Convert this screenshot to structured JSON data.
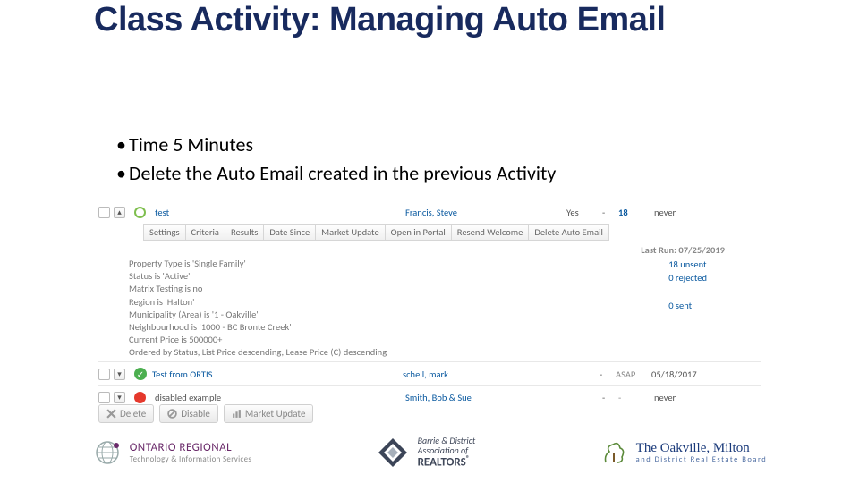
{
  "title": "Class Activity: Managing Auto Email",
  "bullets": [
    "Time 5 Minutes",
    "Delete the Auto Email created in the previous Activity"
  ],
  "emails": [
    {
      "expanded": true,
      "status": "open",
      "name": "test",
      "contact": "Francis, Steve",
      "yes": "Yes",
      "dash": "-",
      "count": "18",
      "countSmall": "",
      "last": "never"
    },
    {
      "expanded": false,
      "status": "green",
      "name": "Test from ORTIS",
      "contact": "schell, mark",
      "yes": "",
      "dash": "-",
      "count": "",
      "countSmall": "ASAP",
      "last": "05/18/2017"
    },
    {
      "expanded": false,
      "status": "red",
      "name": "disabled example",
      "contact": "Smith, Bob & Sue",
      "yes": "",
      "dash": "-",
      "count": "",
      "countSmall": "-",
      "last": "never"
    }
  ],
  "tabs": [
    "Settings",
    "Criteria",
    "Results",
    "Date Since",
    "Market Update",
    "Open in Portal",
    "Resend Welcome",
    "Delete Auto Email"
  ],
  "lastRun": "Last Run: 07/25/2019",
  "criteria": [
    "Property Type is 'Single Family'",
    "Status is 'Active'",
    "Matrix Testing is no",
    "Region is 'Halton'",
    "Municipality (Area) is '1 - Oakville'",
    "Neighbourhood is '1000 - BC Bronte Creek'",
    "Current Price is 500000+",
    "Ordered by Status, List Price descending, Lease Price (C) descending"
  ],
  "stats": {
    "unsent": "18 unsent",
    "rejected": "0 rejected",
    "sent": "0 sent"
  },
  "actions": {
    "delete": "Delete",
    "disable": "Disable",
    "market": "Market Update"
  },
  "logos": {
    "ontario": {
      "line1": "ONTARIO REGIONAL",
      "line2": "Technology & Information Services"
    },
    "barrie": {
      "line1": "Barrie & District",
      "line2": "Association of",
      "line3": "REALTORS"
    },
    "oakville": {
      "line1": "The Oakville, Milton",
      "line2": "and District Real Estate Board"
    }
  }
}
